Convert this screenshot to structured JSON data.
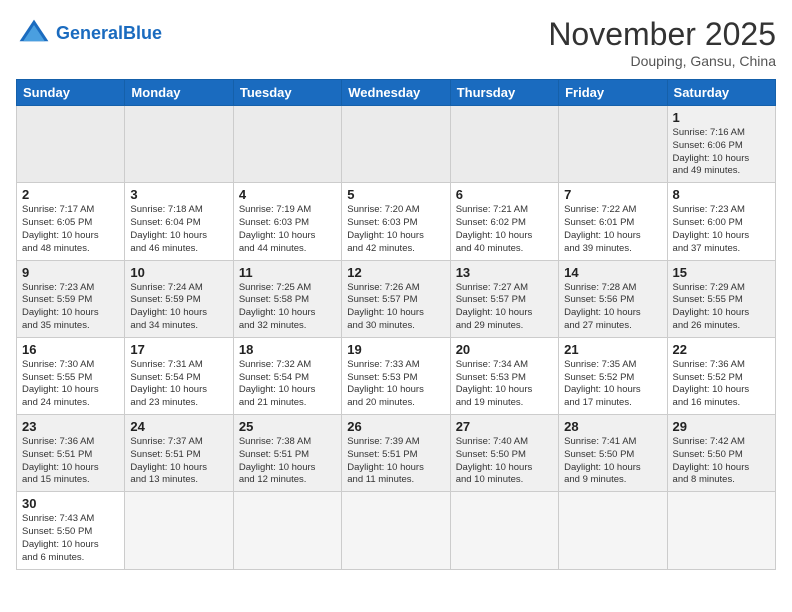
{
  "header": {
    "logo_general": "General",
    "logo_blue": "Blue",
    "month_title": "November 2025",
    "location": "Douping, Gansu, China"
  },
  "weekdays": [
    "Sunday",
    "Monday",
    "Tuesday",
    "Wednesday",
    "Thursday",
    "Friday",
    "Saturday"
  ],
  "weeks": [
    [
      {
        "day": "",
        "info": ""
      },
      {
        "day": "",
        "info": ""
      },
      {
        "day": "",
        "info": ""
      },
      {
        "day": "",
        "info": ""
      },
      {
        "day": "",
        "info": ""
      },
      {
        "day": "",
        "info": ""
      },
      {
        "day": "1",
        "info": "Sunrise: 7:16 AM\nSunset: 6:06 PM\nDaylight: 10 hours\nand 49 minutes."
      }
    ],
    [
      {
        "day": "2",
        "info": "Sunrise: 7:17 AM\nSunset: 6:05 PM\nDaylight: 10 hours\nand 48 minutes."
      },
      {
        "day": "3",
        "info": "Sunrise: 7:18 AM\nSunset: 6:04 PM\nDaylight: 10 hours\nand 46 minutes."
      },
      {
        "day": "4",
        "info": "Sunrise: 7:19 AM\nSunset: 6:03 PM\nDaylight: 10 hours\nand 44 minutes."
      },
      {
        "day": "5",
        "info": "Sunrise: 7:20 AM\nSunset: 6:03 PM\nDaylight: 10 hours\nand 42 minutes."
      },
      {
        "day": "6",
        "info": "Sunrise: 7:21 AM\nSunset: 6:02 PM\nDaylight: 10 hours\nand 40 minutes."
      },
      {
        "day": "7",
        "info": "Sunrise: 7:22 AM\nSunset: 6:01 PM\nDaylight: 10 hours\nand 39 minutes."
      },
      {
        "day": "8",
        "info": "Sunrise: 7:23 AM\nSunset: 6:00 PM\nDaylight: 10 hours\nand 37 minutes."
      }
    ],
    [
      {
        "day": "9",
        "info": "Sunrise: 7:23 AM\nSunset: 5:59 PM\nDaylight: 10 hours\nand 35 minutes."
      },
      {
        "day": "10",
        "info": "Sunrise: 7:24 AM\nSunset: 5:59 PM\nDaylight: 10 hours\nand 34 minutes."
      },
      {
        "day": "11",
        "info": "Sunrise: 7:25 AM\nSunset: 5:58 PM\nDaylight: 10 hours\nand 32 minutes."
      },
      {
        "day": "12",
        "info": "Sunrise: 7:26 AM\nSunset: 5:57 PM\nDaylight: 10 hours\nand 30 minutes."
      },
      {
        "day": "13",
        "info": "Sunrise: 7:27 AM\nSunset: 5:57 PM\nDaylight: 10 hours\nand 29 minutes."
      },
      {
        "day": "14",
        "info": "Sunrise: 7:28 AM\nSunset: 5:56 PM\nDaylight: 10 hours\nand 27 minutes."
      },
      {
        "day": "15",
        "info": "Sunrise: 7:29 AM\nSunset: 5:55 PM\nDaylight: 10 hours\nand 26 minutes."
      }
    ],
    [
      {
        "day": "16",
        "info": "Sunrise: 7:30 AM\nSunset: 5:55 PM\nDaylight: 10 hours\nand 24 minutes."
      },
      {
        "day": "17",
        "info": "Sunrise: 7:31 AM\nSunset: 5:54 PM\nDaylight: 10 hours\nand 23 minutes."
      },
      {
        "day": "18",
        "info": "Sunrise: 7:32 AM\nSunset: 5:54 PM\nDaylight: 10 hours\nand 21 minutes."
      },
      {
        "day": "19",
        "info": "Sunrise: 7:33 AM\nSunset: 5:53 PM\nDaylight: 10 hours\nand 20 minutes."
      },
      {
        "day": "20",
        "info": "Sunrise: 7:34 AM\nSunset: 5:53 PM\nDaylight: 10 hours\nand 19 minutes."
      },
      {
        "day": "21",
        "info": "Sunrise: 7:35 AM\nSunset: 5:52 PM\nDaylight: 10 hours\nand 17 minutes."
      },
      {
        "day": "22",
        "info": "Sunrise: 7:36 AM\nSunset: 5:52 PM\nDaylight: 10 hours\nand 16 minutes."
      }
    ],
    [
      {
        "day": "23",
        "info": "Sunrise: 7:36 AM\nSunset: 5:51 PM\nDaylight: 10 hours\nand 15 minutes."
      },
      {
        "day": "24",
        "info": "Sunrise: 7:37 AM\nSunset: 5:51 PM\nDaylight: 10 hours\nand 13 minutes."
      },
      {
        "day": "25",
        "info": "Sunrise: 7:38 AM\nSunset: 5:51 PM\nDaylight: 10 hours\nand 12 minutes."
      },
      {
        "day": "26",
        "info": "Sunrise: 7:39 AM\nSunset: 5:51 PM\nDaylight: 10 hours\nand 11 minutes."
      },
      {
        "day": "27",
        "info": "Sunrise: 7:40 AM\nSunset: 5:50 PM\nDaylight: 10 hours\nand 10 minutes."
      },
      {
        "day": "28",
        "info": "Sunrise: 7:41 AM\nSunset: 5:50 PM\nDaylight: 10 hours\nand 9 minutes."
      },
      {
        "day": "29",
        "info": "Sunrise: 7:42 AM\nSunset: 5:50 PM\nDaylight: 10 hours\nand 8 minutes."
      }
    ],
    [
      {
        "day": "30",
        "info": "Sunrise: 7:43 AM\nSunset: 5:50 PM\nDaylight: 10 hours\nand 6 minutes."
      },
      {
        "day": "",
        "info": ""
      },
      {
        "day": "",
        "info": ""
      },
      {
        "day": "",
        "info": ""
      },
      {
        "day": "",
        "info": ""
      },
      {
        "day": "",
        "info": ""
      },
      {
        "day": "",
        "info": ""
      }
    ]
  ]
}
